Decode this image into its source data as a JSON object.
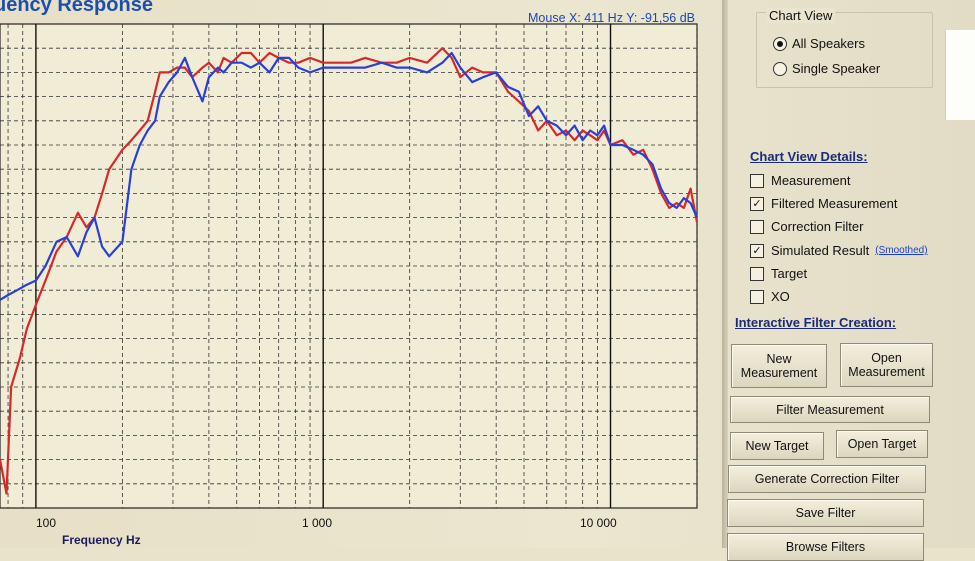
{
  "chart": {
    "title": "uency Response",
    "mouse_readout": "Mouse X: 411 Hz  Y: -91,56 dB",
    "x_tick_labels": [
      "100",
      "1 000",
      "10 000"
    ],
    "x_label": "Frequency Hz"
  },
  "chart_data": {
    "type": "line",
    "title": "uency Response",
    "xlabel": "Frequency Hz",
    "ylabel": "",
    "x_scale": "log",
    "xlim": [
      75,
      20000
    ],
    "x_ticks": [
      100,
      1000,
      10000
    ],
    "ylim": [
      0,
      100
    ],
    "grid": true,
    "legend": "none",
    "series": [
      {
        "color": "#d42a2a",
        "x": [
          75,
          79,
          82,
          88,
          93,
          100,
          108,
          118,
          128,
          140,
          150,
          160,
          170,
          180,
          200,
          215,
          230,
          245,
          260,
          270,
          290,
          310,
          330,
          350,
          380,
          400,
          430,
          450,
          480,
          520,
          560,
          600,
          650,
          700,
          760,
          820,
          900,
          1000,
          1100,
          1250,
          1400,
          1600,
          1800,
          2000,
          2300,
          2600,
          2800,
          3000,
          3300,
          3600,
          4000,
          4400,
          4800,
          5200,
          5600,
          6000,
          6500,
          7000,
          7500,
          8000,
          8500,
          9000,
          9500,
          10000,
          11000,
          12000,
          13000,
          14000,
          15000,
          16000,
          17000,
          18000,
          19000,
          20000
        ],
        "values": [
          10,
          3,
          25,
          31,
          37,
          42,
          47,
          53,
          56,
          61,
          58,
          60,
          65,
          70,
          74,
          76,
          78,
          80,
          86,
          90,
          90,
          91,
          91,
          89,
          91,
          92,
          90,
          93,
          92,
          94,
          94,
          92,
          94,
          93,
          92,
          92,
          93,
          92,
          92,
          92,
          93,
          92,
          92,
          93,
          92,
          95,
          93,
          89,
          91,
          90,
          90,
          86,
          84,
          82,
          78,
          80,
          77,
          78,
          76,
          78,
          77,
          76,
          78,
          75,
          76,
          73,
          74,
          70,
          65,
          62,
          63,
          62,
          66,
          59
        ]
      },
      {
        "color": "#2a3fd6",
        "x": [
          75,
          80,
          86,
          92,
          100,
          108,
          118,
          128,
          140,
          150,
          160,
          170,
          180,
          200,
          215,
          230,
          245,
          260,
          270,
          290,
          310,
          330,
          350,
          380,
          400,
          430,
          450,
          480,
          520,
          560,
          600,
          650,
          700,
          760,
          820,
          900,
          1000,
          1100,
          1250,
          1400,
          1600,
          1800,
          2000,
          2300,
          2600,
          2800,
          3000,
          3300,
          3600,
          4000,
          4400,
          4800,
          5200,
          5600,
          6000,
          6500,
          7000,
          7500,
          8000,
          8500,
          9000,
          9500,
          10000,
          11000,
          12000,
          13000,
          14000,
          15000,
          16000,
          17000,
          18000,
          19000,
          20000
        ],
        "values": [
          43,
          44,
          45,
          46,
          47,
          50,
          55,
          56,
          52,
          57,
          60,
          54,
          52,
          55,
          70,
          75,
          78,
          80,
          85,
          88,
          90,
          93,
          89,
          84,
          89,
          91,
          90,
          92,
          92,
          91,
          92,
          90,
          93,
          93,
          91,
          90,
          91,
          91,
          91,
          91,
          92,
          91,
          91,
          90,
          92,
          94,
          91,
          88,
          89,
          90,
          87,
          86,
          81,
          83,
          80,
          79,
          77,
          79,
          76,
          78,
          77,
          79,
          75,
          75,
          74,
          73,
          71,
          66,
          63,
          62,
          64,
          63,
          60
        ]
      }
    ]
  },
  "panel": {
    "chart_view": {
      "title": "Chart View",
      "options": [
        {
          "label": "All Speakers",
          "selected": true
        },
        {
          "label": "Single Speaker",
          "selected": false
        }
      ]
    },
    "details": {
      "title": "Chart View Details:",
      "items": [
        {
          "label": "Measurement",
          "checked": false
        },
        {
          "label": "Filtered Measurement",
          "checked": true
        },
        {
          "label": "Correction Filter",
          "checked": false
        },
        {
          "label": "Simulated Result",
          "checked": true,
          "link": "(Smoothed)"
        },
        {
          "label": "Target",
          "checked": false
        },
        {
          "label": "XO",
          "checked": false
        }
      ]
    },
    "interactive": {
      "title": "Interactive Filter Creation:",
      "new_measurement": "New\nMeasurement",
      "open_measurement": "Open\nMeasurement",
      "filter_measurement": "Filter Measurement",
      "new_target": "New Target",
      "open_target": "Open Target",
      "generate_correction": "Generate Correction Filter",
      "save_filter": "Save Filter",
      "browse_filters": "Browse Filters"
    }
  }
}
